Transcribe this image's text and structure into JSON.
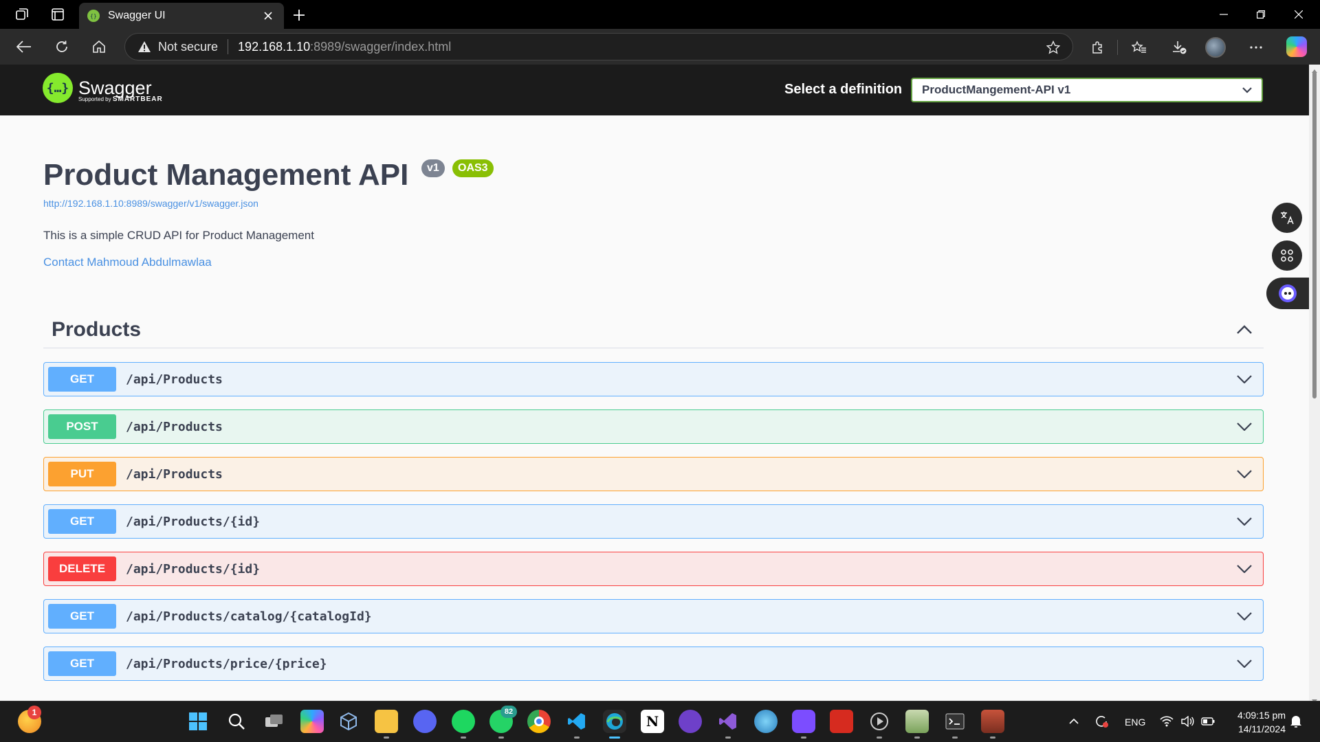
{
  "browser": {
    "tab_title": "Swagger UI",
    "security_label": "Not secure",
    "url_host": "192.168.1.10",
    "url_rest": ":8989/swagger/index.html"
  },
  "swagger": {
    "logo_text": "Swagger",
    "logo_sub_prefix": "Supported by",
    "logo_sub_brand": "SMARTBEAR",
    "definition_label": "Select a definition",
    "definition_value": "ProductMangement-API v1"
  },
  "info": {
    "title": "Product Management API",
    "version_badge": "v1",
    "oas_badge": "OAS3",
    "spec_url": "http://192.168.1.10:8989/swagger/v1/swagger.json",
    "description": "This is a simple CRUD API for Product Management",
    "contact": "Contact Mahmoud Abdulmawlaa"
  },
  "tag": {
    "name": "Products"
  },
  "operations": [
    {
      "method": "GET",
      "path": "/api/Products"
    },
    {
      "method": "POST",
      "path": "/api/Products"
    },
    {
      "method": "PUT",
      "path": "/api/Products"
    },
    {
      "method": "GET",
      "path": "/api/Products/{id}"
    },
    {
      "method": "DELETE",
      "path": "/api/Products/{id}"
    },
    {
      "method": "GET",
      "path": "/api/Products/catalog/{catalogId}"
    },
    {
      "method": "GET",
      "path": "/api/Products/price/{price}"
    }
  ],
  "taskbar": {
    "weather_badge": "1",
    "whatsapp_badge": "82",
    "language": "ENG",
    "time": "4:09:15 pm",
    "date": "14/11/2024"
  },
  "colors": {
    "get": "#61affe",
    "post": "#49cc90",
    "put": "#fca130",
    "delete": "#f93e3e",
    "swagger_green": "#85ea2d",
    "link": "#4990e2"
  }
}
